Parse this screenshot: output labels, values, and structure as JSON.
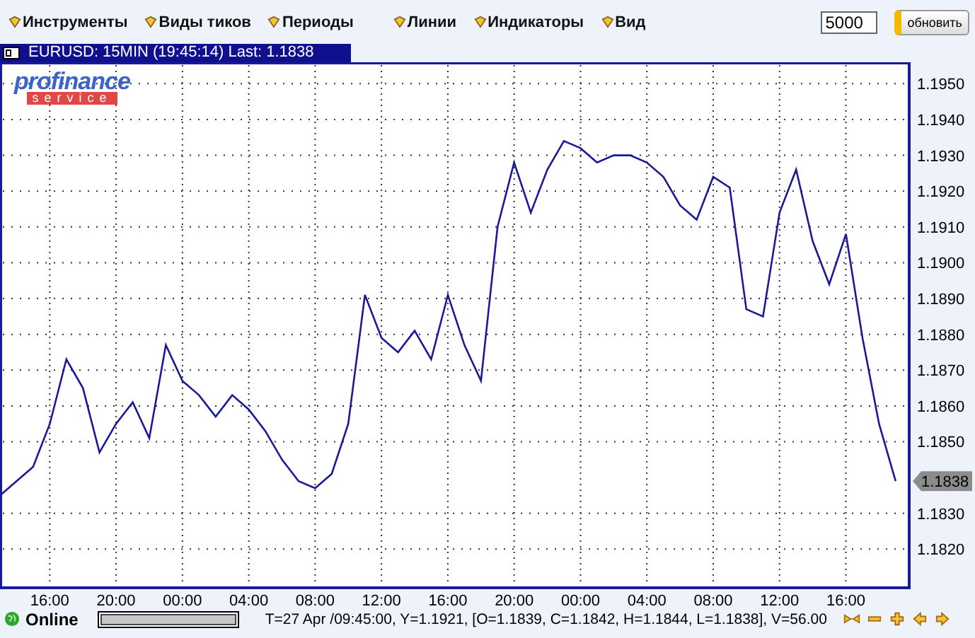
{
  "menu": [
    {
      "label": "Инструменты"
    },
    {
      "label": "Виды тиков"
    },
    {
      "label": "Периоды"
    },
    {
      "label": "Линии"
    },
    {
      "label": "Индикаторы"
    },
    {
      "label": "Вид"
    }
  ],
  "bars_field": {
    "value": "5000"
  },
  "refresh_button": {
    "label": "обновить"
  },
  "chart_title": "EURUSD: 15MIN (19:45:14) Last: 1.1838",
  "logo": {
    "top": "profinance",
    "bottom": "service"
  },
  "chart": {
    "chart_data": {
      "type": "line",
      "categories": [
        null,
        null,
        null,
        "16:00",
        null,
        null,
        null,
        "20:00",
        null,
        null,
        null,
        "00:00",
        null,
        null,
        null,
        "04:00",
        null,
        null,
        null,
        "08:00",
        null,
        null,
        null,
        "12:00",
        null,
        null,
        null,
        "16:00",
        null,
        null,
        null,
        "20:00",
        null,
        null,
        null,
        "00:00",
        null,
        null,
        null,
        "04:00",
        null,
        null,
        null,
        "08:00",
        null,
        null,
        null,
        "12:00",
        null,
        null,
        null,
        "16:00",
        null,
        null,
        null
      ],
      "series": [
        {
          "color": "#1a1a99",
          "values": [
            1.1835,
            1.1839,
            1.1843,
            1.1855,
            1.1873,
            1.1865,
            1.1847,
            1.1855,
            1.1861,
            1.1851,
            1.1877,
            1.1867,
            1.1863,
            1.1857,
            1.1863,
            1.1859,
            1.1853,
            1.1845,
            1.1839,
            1.1837,
            1.1841,
            1.1855,
            1.1891,
            1.1879,
            1.1875,
            1.1881,
            1.1873,
            1.1891,
            1.1877,
            1.1867,
            1.191,
            1.1928,
            1.1914,
            1.1926,
            1.1934,
            1.1932,
            1.1928,
            1.193,
            1.193,
            1.1928,
            1.1924,
            1.1916,
            1.1912,
            1.1924,
            1.1921,
            1.1887,
            1.1885,
            1.1914,
            1.1926,
            1.1906,
            1.1894,
            1.1908,
            1.1879,
            1.1855,
            1.1839
          ]
        }
      ],
      "ylim": [
        1.1809,
        1.1956
      ],
      "yticks": [
        {
          "value": 1.195,
          "label": "1.1950"
        },
        {
          "value": 1.194,
          "label": "1.1940"
        },
        {
          "value": 1.193,
          "label": "1.1930"
        },
        {
          "value": 1.192,
          "label": "1.1920"
        },
        {
          "value": 1.191,
          "label": "1.1910"
        },
        {
          "value": 1.19,
          "label": "1.1900"
        },
        {
          "value": 1.189,
          "label": "1.1890"
        },
        {
          "value": 1.188,
          "label": "1.1880"
        },
        {
          "value": 1.187,
          "label": "1.1870"
        },
        {
          "value": 1.186,
          "label": "1.1860"
        },
        {
          "value": 1.185,
          "label": "1.1850"
        },
        {
          "value": 1.183,
          "label": "1.1830"
        },
        {
          "value": 1.182,
          "label": "1.1820"
        }
      ],
      "grid": true
    },
    "last_price": "1.1838"
  },
  "status": {
    "connection": "Online",
    "online": true,
    "progress": {
      "level": 1
    },
    "info": "T=27 Apr /09:45:00, Y=1.1921, [O=1.1839, C=1.1842, H=1.1844, L=1.1838], V=56.00"
  }
}
